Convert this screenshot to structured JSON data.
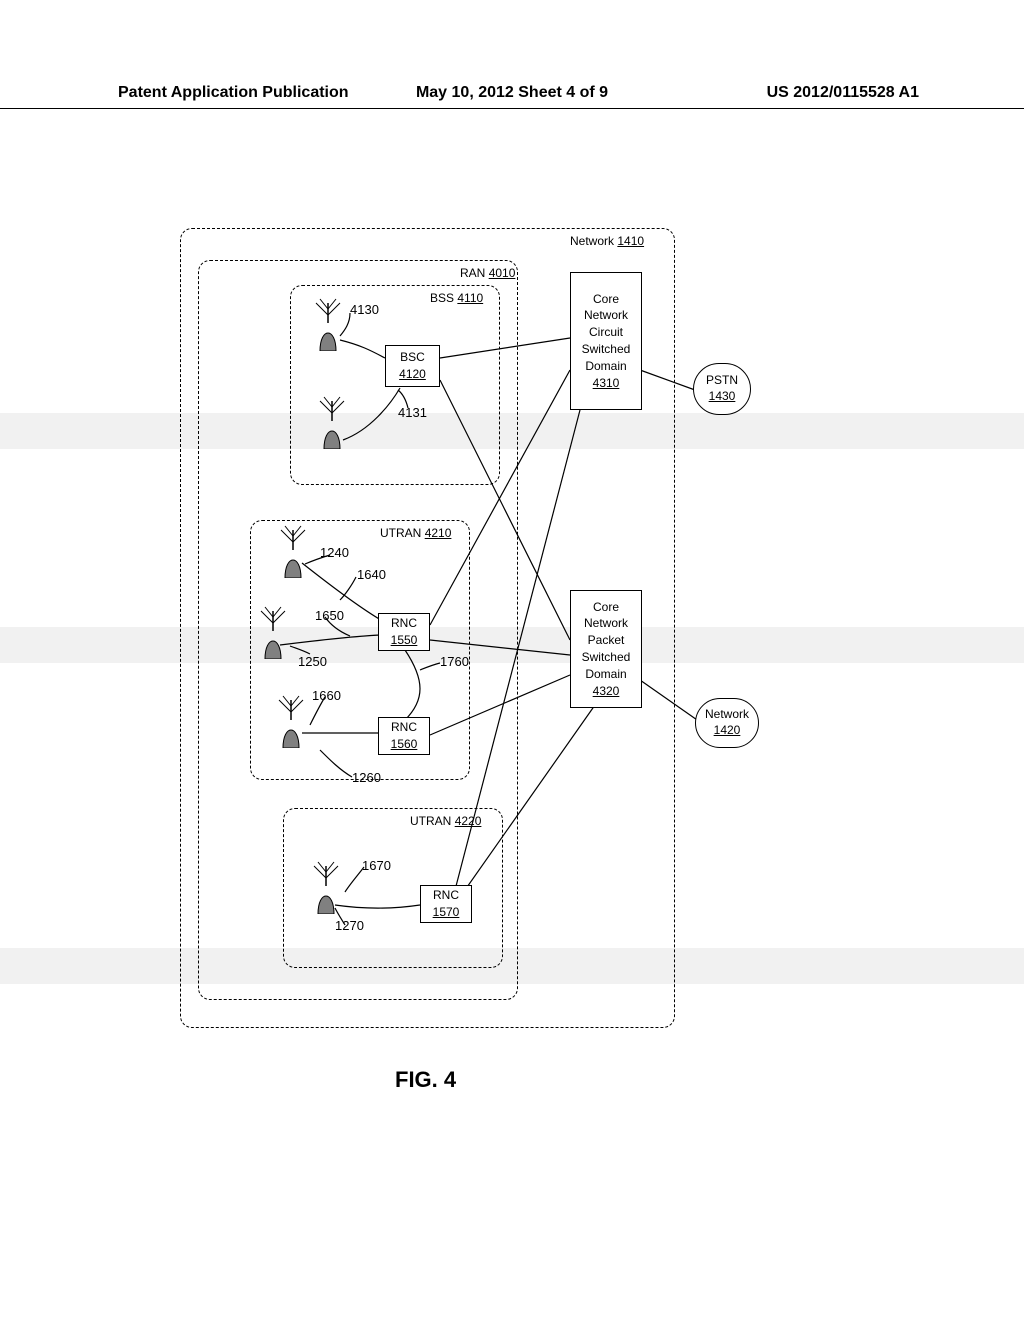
{
  "header": {
    "left": "Patent Application Publication",
    "center": "May 10, 2012  Sheet 4 of 9",
    "right": "US 2012/0115528 A1"
  },
  "figure_caption": "FIG. 4",
  "containers": {
    "network": {
      "label": "Network",
      "num": "1410"
    },
    "ran": {
      "label": "RAN",
      "num": "4010"
    },
    "bss": {
      "label": "BSS",
      "num": "4110"
    },
    "utran1": {
      "label": "UTRAN",
      "num": "4210"
    },
    "utran2": {
      "label": "UTRAN",
      "num": "4220"
    }
  },
  "boxes": {
    "bsc": {
      "label": "BSC",
      "num": "4120"
    },
    "rnc1": {
      "label": "RNC",
      "num": "1550"
    },
    "rnc2": {
      "label": "RNC",
      "num": "1560"
    },
    "rnc3": {
      "label": "RNC",
      "num": "1570"
    },
    "core_cs": {
      "l1": "Core",
      "l2": "Network",
      "l3": "Circuit",
      "l4": "Switched",
      "l5": "Domain",
      "num": "4310"
    },
    "core_ps": {
      "l1": "Core",
      "l2": "Network",
      "l3": "Packet",
      "l4": "Switched",
      "l5": "Domain",
      "num": "4320"
    }
  },
  "external": {
    "pstn": {
      "label": "PSTN",
      "num": "1430"
    },
    "net": {
      "label": "Network",
      "num": "1420"
    }
  },
  "annotations": {
    "a4130": "4130",
    "a4131": "4131",
    "a1240": "1240",
    "a1640": "1640",
    "a1650": "1650",
    "a1250": "1250",
    "a1760": "1760",
    "a1660": "1660",
    "a1260": "1260",
    "a1670": "1670",
    "a1270": "1270"
  },
  "chart_data": {
    "type": "diagram",
    "title": "FIG. 4 - Network architecture",
    "nodes": [
      {
        "id": "1410",
        "label": "Network",
        "kind": "container"
      },
      {
        "id": "4010",
        "label": "RAN",
        "kind": "container",
        "parent": "1410"
      },
      {
        "id": "4110",
        "label": "BSS",
        "kind": "container",
        "parent": "4010"
      },
      {
        "id": "4210",
        "label": "UTRAN",
        "kind": "container",
        "parent": "4010"
      },
      {
        "id": "4220",
        "label": "UTRAN",
        "kind": "container",
        "parent": "4010"
      },
      {
        "id": "4120",
        "label": "BSC",
        "kind": "box",
        "parent": "4110"
      },
      {
        "id": "1550",
        "label": "RNC",
        "kind": "box",
        "parent": "4210"
      },
      {
        "id": "1560",
        "label": "RNC",
        "kind": "box",
        "parent": "4210"
      },
      {
        "id": "1570",
        "label": "RNC",
        "kind": "box",
        "parent": "4220"
      },
      {
        "id": "4310",
        "label": "Core Network Circuit Switched Domain",
        "kind": "box",
        "parent": "1410"
      },
      {
        "id": "4320",
        "label": "Core Network Packet Switched Domain",
        "kind": "box",
        "parent": "1410"
      },
      {
        "id": "4130",
        "label": "antenna",
        "kind": "antenna",
        "parent": "4110"
      },
      {
        "id": "4131",
        "label": "antenna",
        "kind": "antenna",
        "parent": "4110"
      },
      {
        "id": "1240",
        "label": "antenna",
        "kind": "antenna",
        "parent": "4210"
      },
      {
        "id": "1250",
        "label": "antenna",
        "kind": "antenna",
        "parent": "4210"
      },
      {
        "id": "1260",
        "label": "antenna",
        "kind": "antenna",
        "parent": "4210"
      },
      {
        "id": "1270",
        "label": "antenna",
        "kind": "antenna",
        "parent": "4220"
      },
      {
        "id": "1430",
        "label": "PSTN",
        "kind": "external"
      },
      {
        "id": "1420",
        "label": "Network",
        "kind": "external"
      }
    ],
    "edges": [
      {
        "from": "4130",
        "to": "4120"
      },
      {
        "from": "4131",
        "to": "4120"
      },
      {
        "from": "4120",
        "to": "4310"
      },
      {
        "from": "4120",
        "to": "4320"
      },
      {
        "from": "1240",
        "to": "1550",
        "via": "1640"
      },
      {
        "from": "1250",
        "to": "1550",
        "via": "1650"
      },
      {
        "from": "1260",
        "to": "1560",
        "via": "1660"
      },
      {
        "from": "1550",
        "to": "1560",
        "via": "1760"
      },
      {
        "from": "1550",
        "to": "4310"
      },
      {
        "from": "1550",
        "to": "4320"
      },
      {
        "from": "1560",
        "to": "4320"
      },
      {
        "from": "1270",
        "to": "1570",
        "via": "1670"
      },
      {
        "from": "1570",
        "to": "4310"
      },
      {
        "from": "1570",
        "to": "4320"
      },
      {
        "from": "4310",
        "to": "1430"
      },
      {
        "from": "4320",
        "to": "1420"
      }
    ]
  }
}
